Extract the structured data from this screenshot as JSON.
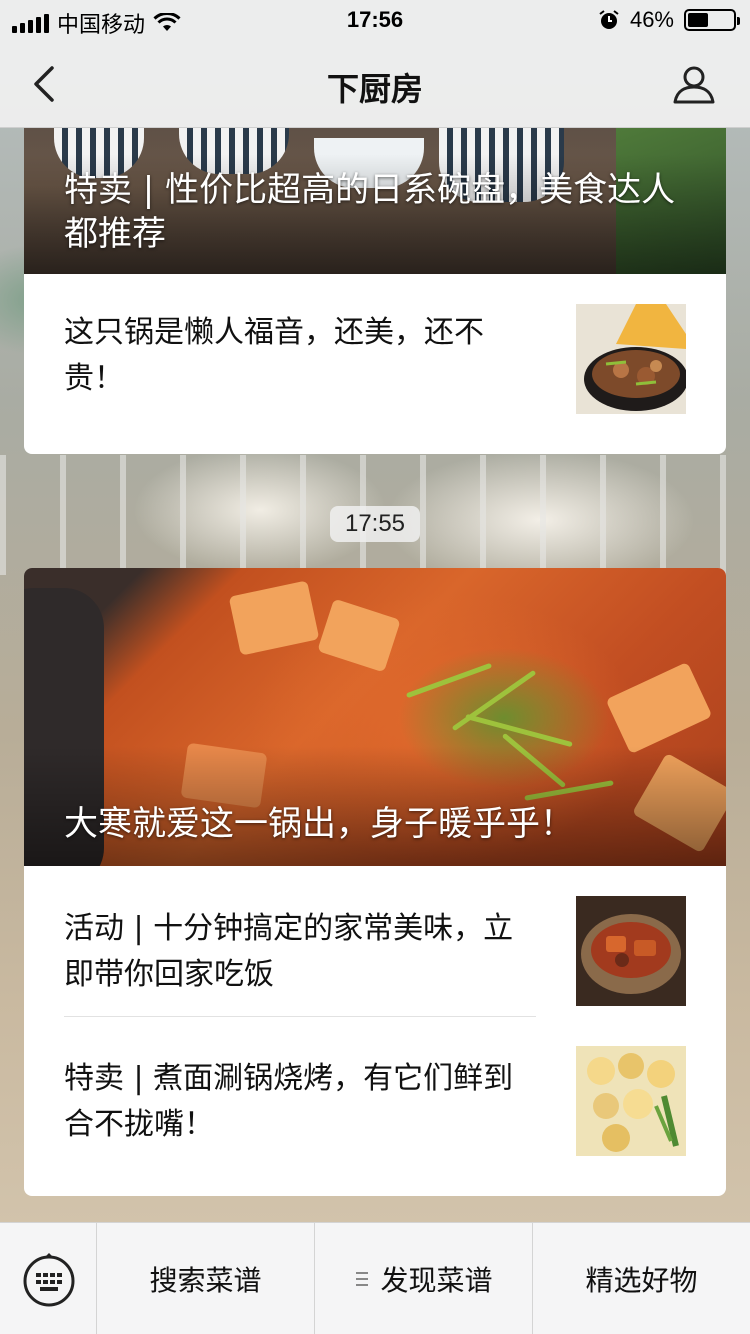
{
  "status_bar": {
    "carrier": "中国移动",
    "time": "17:56",
    "battery": "46%",
    "battery_level": 0.46
  },
  "nav": {
    "title": "下厨房",
    "back_icon": "chevron-left-icon",
    "profile_icon": "person-icon"
  },
  "messages": [
    {
      "cover_title": "特卖 | 性价比超高的日系碗盘，美食达人都推荐",
      "items": [
        {
          "text": "这只锅是懒人福音，还美，还不贵！"
        }
      ]
    },
    {
      "timestamp": "17:55",
      "cover_title": "大寒就爱这一锅出，身子暖乎乎！",
      "items": [
        {
          "text": "活动 | 十分钟搞定的家常美味，立即带你回家吃饭"
        },
        {
          "text": "特卖 | 煮面涮锅烧烤，有它们鲜到合不拢嘴！"
        }
      ]
    }
  ],
  "bottom_menu": {
    "keyboard_icon": "keyboard-icon",
    "items": [
      {
        "label": "搜索菜谱"
      },
      {
        "label": "发现菜谱",
        "has_submenu": true
      },
      {
        "label": "精选好物"
      }
    ]
  }
}
